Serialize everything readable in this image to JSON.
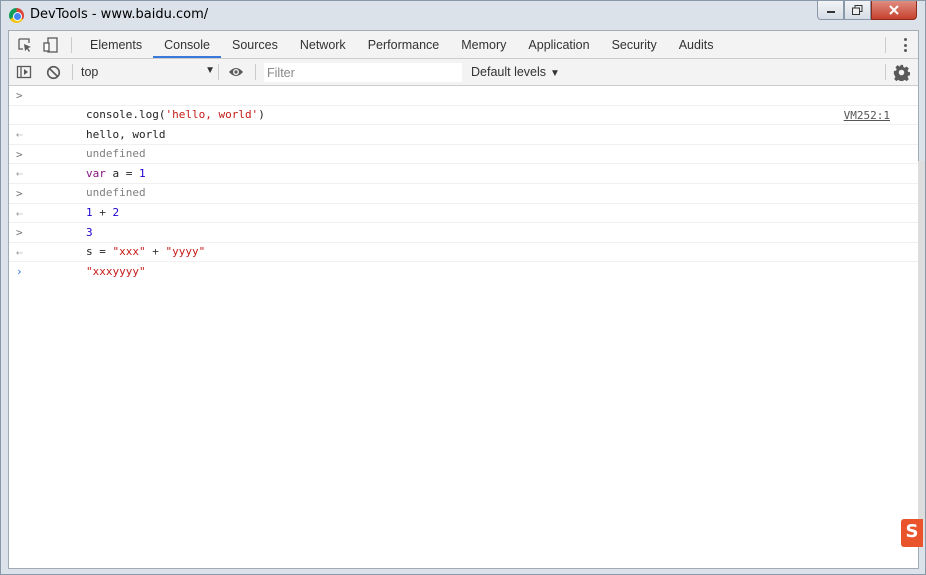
{
  "window": {
    "title": "DevTools - www.baidu.com/",
    "controls": {
      "minimize": "▭",
      "maximize": "⧉",
      "close": "✕"
    }
  },
  "devtools": {
    "tabs": [
      "Elements",
      "Console",
      "Sources",
      "Network",
      "Performance",
      "Memory",
      "Application",
      "Security",
      "Audits"
    ],
    "active_tab": "Console",
    "toolbar": {
      "context": "top",
      "filter_placeholder": "Filter",
      "levels": "Default levels"
    }
  },
  "console": {
    "row1_code": "console.log(",
    "row1_str": "'hello, world'",
    "row1_end": ")",
    "row2_text": "hello, world",
    "row2_src": "VM252:1",
    "row3_text": "undefined",
    "row4_kw": "var",
    "row4_rest": " a = ",
    "row4_num": "1",
    "row5_text": "undefined",
    "row6_a": "1",
    "row6_op": " + ",
    "row6_b": "2",
    "row7_text": "3",
    "row8_var": "s = ",
    "row8_s1": "\"xxx\"",
    "row8_op": " + ",
    "row8_s2": "\"yyyy\"",
    "row9_text": "\"xxxyyyy\"",
    "prompt": "›"
  },
  "ime_label": "S"
}
